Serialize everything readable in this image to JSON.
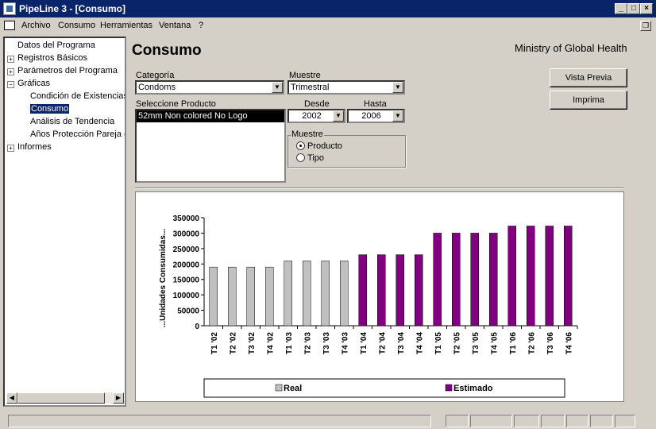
{
  "window": {
    "title": "PipeLine 3 - [Consumo]"
  },
  "menu": {
    "items": [
      "Archivo",
      "Consumo",
      "Herramientas",
      "Ventana",
      "?"
    ]
  },
  "tree": {
    "items": [
      {
        "label": "Datos del Programa",
        "expandable": false,
        "level": 0
      },
      {
        "label": "Registros Básicos",
        "expandable": true,
        "level": 0
      },
      {
        "label": "Parámetros del Programa",
        "expandable": true,
        "level": 0
      },
      {
        "label": "Gráficas",
        "expandable": true,
        "expanded": true,
        "level": 0
      },
      {
        "label": "Condición de Existencias",
        "level": 1
      },
      {
        "label": "Consumo",
        "level": 1,
        "selected": true
      },
      {
        "label": "Análisis de Tendencia",
        "level": 1
      },
      {
        "label": "Años Protección Pareja (A",
        "level": 1
      },
      {
        "label": "Informes",
        "expandable": true,
        "level": 0
      }
    ]
  },
  "page": {
    "heading": "Consumo",
    "ministry": "Ministry of Global Health",
    "categoria_label": "Categoría",
    "categoria_value": "Condoms",
    "muestre_label": "Muestre",
    "muestre_value": "Trimestral",
    "producto_label": "Seleccione Producto",
    "producto_selected": "52mm Non colored No Logo",
    "desde_label": "Desde",
    "desde_value": "2002",
    "hasta_label": "Hasta",
    "hasta_value": "2006",
    "group_label": "Muestre",
    "radio_producto": "Producto",
    "radio_tipo": "Tipo",
    "vista_previa": "Vista Previa",
    "imprima": "Imprima"
  },
  "colors": {
    "real": "#c0c0c0",
    "estimado": "#800080",
    "title_bar": "#0a246a"
  },
  "chart_data": {
    "type": "bar",
    "ylabel": "...Unidades Consumidas...",
    "ylim": [
      0,
      350000
    ],
    "yticks": [
      "350000",
      "300000",
      "250000",
      "200000",
      "150000",
      "100000",
      "50000",
      "0"
    ],
    "categories": [
      "T1 '02",
      "T2 '02",
      "T3 '02",
      "T4 '02",
      "T1 '03",
      "T2 '03",
      "T3 '03",
      "T4 '03",
      "T1 '04",
      "T2 '04",
      "T3 '04",
      "T4 '04",
      "T1 '05",
      "T2 '05",
      "T3 '05",
      "T4 '05",
      "T1 '06",
      "T2 '06",
      "T3 '06",
      "T4 '06"
    ],
    "series": [
      {
        "name": "Real",
        "values": [
          190000,
          190000,
          190000,
          190000,
          210000,
          210000,
          210000,
          210000,
          null,
          null,
          null,
          null,
          null,
          null,
          null,
          null,
          null,
          null,
          null,
          null
        ]
      },
      {
        "name": "Estimado",
        "values": [
          null,
          null,
          null,
          null,
          null,
          null,
          null,
          null,
          230000,
          230000,
          230000,
          230000,
          300000,
          300000,
          300000,
          300000,
          323000,
          323000,
          323000,
          323000
        ]
      }
    ],
    "legend": [
      "Real",
      "Estimado"
    ],
    "legend_position": "bottom"
  }
}
